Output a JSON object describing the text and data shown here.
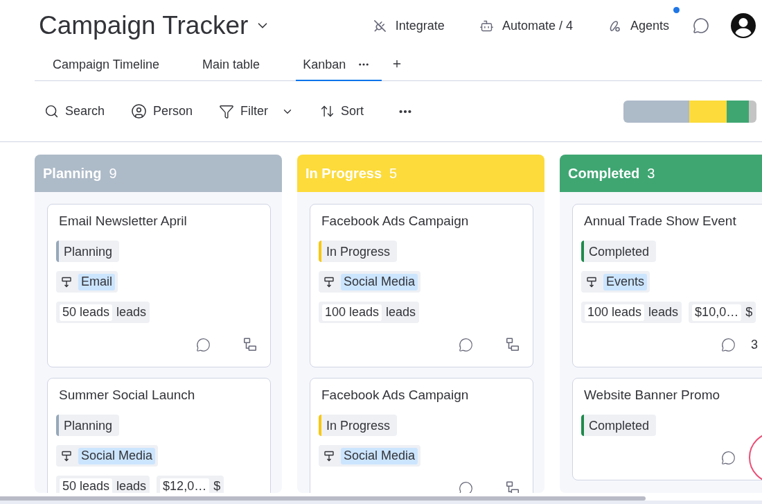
{
  "board": {
    "title": "Campaign Tracker"
  },
  "header_actions": [
    {
      "kind": "integrate",
      "label": "Integrate",
      "notified": false
    },
    {
      "kind": "automate",
      "label": "Automate / 4",
      "notified": false
    },
    {
      "kind": "agents",
      "label": "Agents",
      "notified": true
    }
  ],
  "views": [
    {
      "label": "Campaign Timeline",
      "selected": false
    },
    {
      "label": "Main table",
      "selected": false
    },
    {
      "label": "Kanban",
      "selected": true
    }
  ],
  "toolbar": [
    {
      "kind": "search",
      "label": "Search"
    },
    {
      "kind": "person",
      "label": "Person"
    },
    {
      "kind": "filter",
      "label": "Filter"
    },
    {
      "kind": "sort",
      "label": "Sort"
    }
  ],
  "columns": [
    {
      "title": "Planning",
      "count": "9",
      "color": "#adbac8",
      "cards": [
        {
          "title": "Email Newsletter April",
          "status": {
            "label": "Planning",
            "color": "#97a8ba"
          },
          "channel": "Email",
          "fields": [
            {
              "value": "50 leads",
              "unit": "leads"
            }
          ],
          "comments": true,
          "subitems": true
        },
        {
          "title": "Summer Social Launch",
          "status": {
            "label": "Planning",
            "color": "#97a8ba"
          },
          "channel": "Social Media",
          "fields": [
            {
              "value": "50 leads",
              "unit": "leads"
            },
            {
              "value": "$12,0…",
              "unit": "$"
            }
          ]
        }
      ]
    },
    {
      "title": "In Progress",
      "count": "5",
      "color": "#fcdb3b",
      "cards": [
        {
          "title": "Facebook Ads Campaign",
          "status": {
            "label": "In Progress",
            "color": "#f9c80e"
          },
          "channel": "Social Media",
          "fields": [
            {
              "value": "100 leads",
              "unit": "leads"
            }
          ],
          "comments": true,
          "subitems": true
        },
        {
          "title": "Facebook Ads Campaign",
          "status": {
            "label": "In Progress",
            "color": "#f9c80e"
          },
          "channel": "Social Media",
          "comments": true,
          "subitems": true
        }
      ]
    },
    {
      "title": "Completed",
      "count": "3",
      "color": "#3fa672",
      "cards": [
        {
          "title": "Annual Trade Show Event",
          "status": {
            "label": "Completed",
            "color": "#1e8a4c"
          },
          "channel": "Events",
          "fields": [
            {
              "value": "100 leads",
              "unit": "leads"
            },
            {
              "value": "$10,0…",
              "unit": "$"
            }
          ],
          "comments": true,
          "subitems_count": "3"
        },
        {
          "title": "Website Banner Promo",
          "status": {
            "label": "Completed",
            "color": "#1e8a4c"
          },
          "comments": true
        }
      ]
    }
  ]
}
